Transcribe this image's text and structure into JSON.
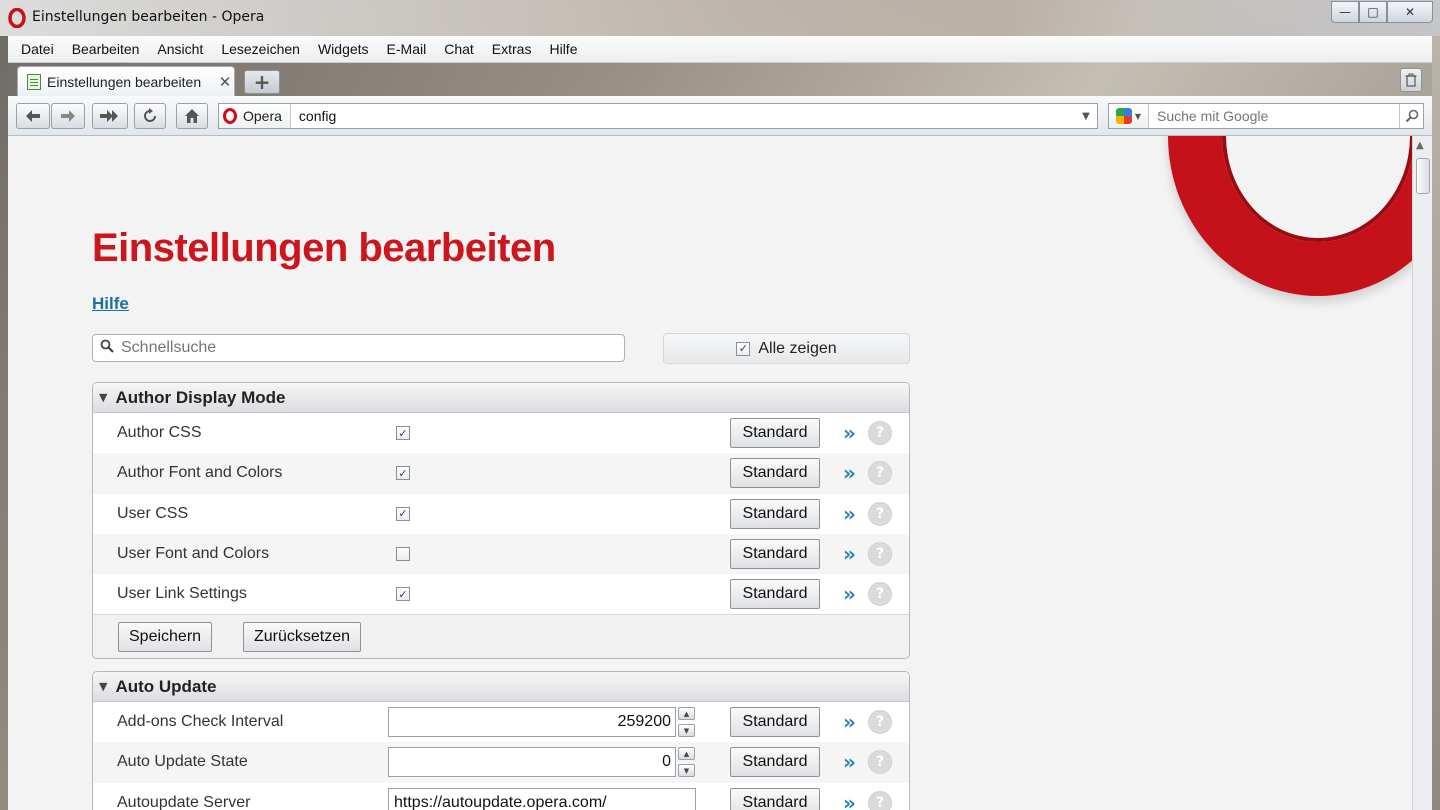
{
  "window": {
    "title": "Einstellungen bearbeiten - Opera",
    "controls": {
      "minimize": "—",
      "maximize": "□",
      "close": "✕"
    }
  },
  "menu": [
    "Datei",
    "Bearbeiten",
    "Ansicht",
    "Lesezeichen",
    "Widgets",
    "E-Mail",
    "Chat",
    "Extras",
    "Hilfe"
  ],
  "tab": {
    "title": "Einstellungen bearbeiten",
    "close": "✕",
    "new_tab": "+"
  },
  "toolbar": {
    "badge": "Opera",
    "url": "config",
    "search_placeholder": "Suche mit Google"
  },
  "page": {
    "title": "Einstellungen bearbeiten",
    "help": "Hilfe",
    "quicksearch_placeholder": "Schnellsuche",
    "show_all": {
      "label": "Alle zeigen",
      "checked": true
    }
  },
  "sections": {
    "author": {
      "title": "Author Display Mode",
      "rows": [
        {
          "label": "Author CSS",
          "checked": true
        },
        {
          "label": "Author Font and Colors",
          "checked": true
        },
        {
          "label": "User CSS",
          "checked": true
        },
        {
          "label": "User Font and Colors",
          "checked": false
        },
        {
          "label": "User Link Settings",
          "checked": true
        }
      ],
      "save": "Speichern",
      "reset": "Zurücksetzen"
    },
    "update": {
      "title": "Auto Update",
      "rows": [
        {
          "label": "Add-ons Check Interval",
          "value": "259200"
        },
        {
          "label": "Auto Update State",
          "value": "0"
        },
        {
          "label": "Autoupdate Server",
          "value": "https://autoupdate.opera.com/"
        }
      ]
    }
  },
  "labels": {
    "standard": "Standard",
    "more": "»",
    "help_q": "?"
  },
  "colors": {
    "accent": "#cc151c",
    "link": "#1a6fa3",
    "more_arrow": "#2a7fb8"
  }
}
